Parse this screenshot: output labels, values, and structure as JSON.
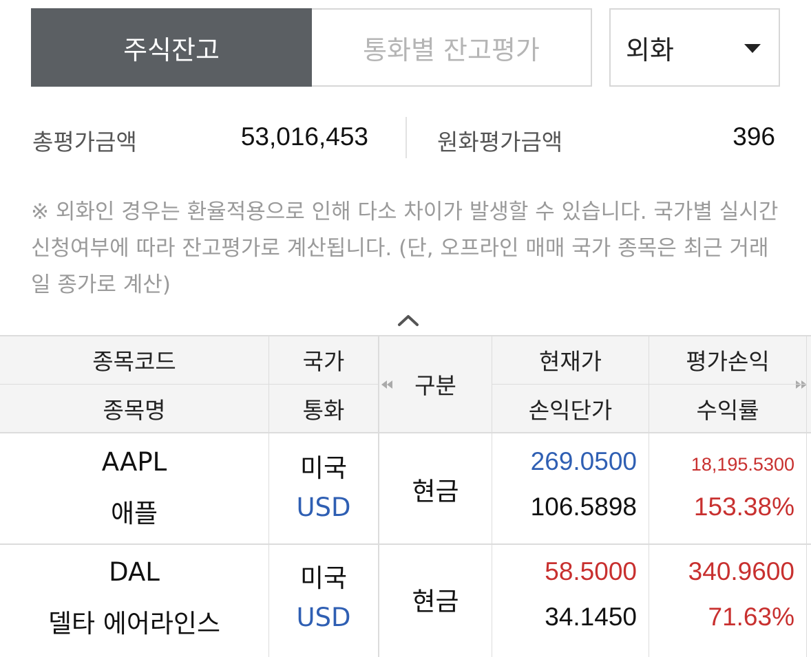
{
  "tabs": {
    "stock_balance": "주식잔고",
    "currency_eval": "통화별 잔고평가"
  },
  "currency_select": {
    "value": "외화"
  },
  "summary": {
    "total_label": "총평가금액",
    "total_value": "53,016,453",
    "krw_label": "원화평가금액",
    "krw_value": "396"
  },
  "notice": "※ 외화인 경우는 환율적용으로 인해 다소 차이가 발생할 수 있습니다. 국가별 실시간 신청여부에 따라 잔고평가로 계산됩니다. (단, 오프라인 매매 국가 종목은 최근 거래일 종가로 계산)",
  "table": {
    "headers": {
      "code": "종목코드",
      "name": "종목명",
      "country": "국가",
      "currency": "통화",
      "type": "구분",
      "current_price": "현재가",
      "avg_price": "손익단가",
      "eval_pl": "평가손익",
      "return_rate": "수익률"
    },
    "rows": [
      {
        "code": "AAPL",
        "name": "애플",
        "country": "미국",
        "currency": "USD",
        "type": "현금",
        "current_price": "269.0500",
        "avg_price": "106.5898",
        "eval_pl": "18,195.5300",
        "return_rate": "153.38%"
      },
      {
        "code": "DAL",
        "name": "델타 에어라인스",
        "country": "미국",
        "currency": "USD",
        "type": "현금",
        "current_price": "58.5000",
        "avg_price": "34.1450",
        "eval_pl": "340.9600",
        "return_rate": "71.63%"
      }
    ]
  },
  "colors": {
    "tab_active_bg": "#5b5f63",
    "blue": "#2f5fb3",
    "red": "#c8302f",
    "header_bg": "#f4f4f4"
  }
}
